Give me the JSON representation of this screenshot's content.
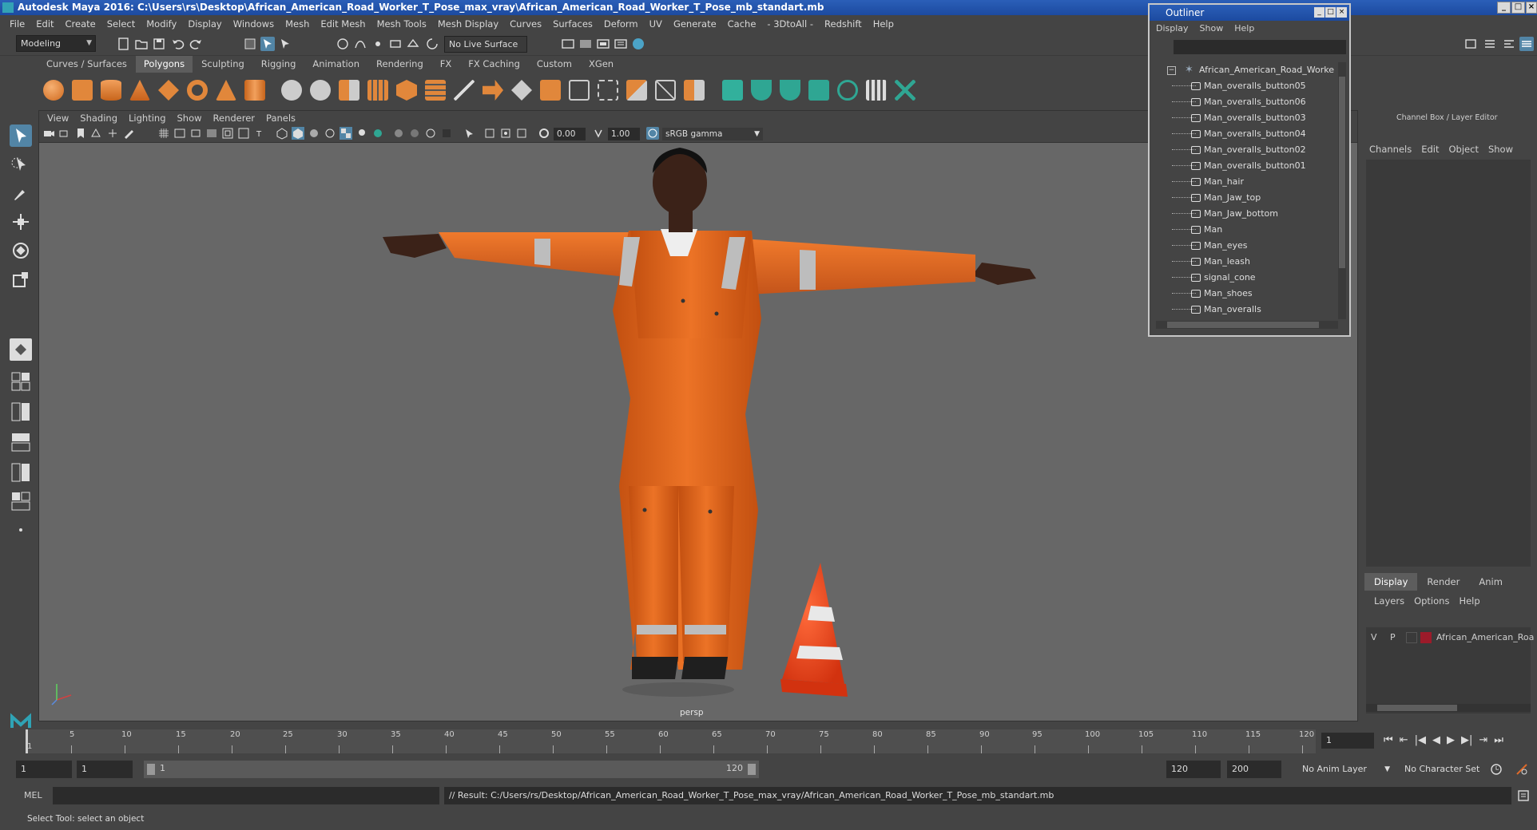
{
  "window": {
    "title": "Autodesk Maya 2016: C:\\Users\\rs\\Desktop\\African_American_Road_Worker_T_Pose_max_vray\\African_American_Road_Worker_T_Pose_mb_standart.mb"
  },
  "menu": [
    "File",
    "Edit",
    "Create",
    "Select",
    "Modify",
    "Display",
    "Windows",
    "Mesh",
    "Edit Mesh",
    "Mesh Tools",
    "Mesh Display",
    "Curves",
    "Surfaces",
    "Deform",
    "UV",
    "Generate",
    "Cache",
    "- 3DtoAll -",
    "Redshift",
    "Help"
  ],
  "status_line": {
    "mode": "Modeling",
    "live_surface": "No Live Surface"
  },
  "shelf_tabs": [
    "Curves / Surfaces",
    "Polygons",
    "Sculpting",
    "Rigging",
    "Animation",
    "Rendering",
    "FX",
    "FX Caching",
    "Custom",
    "XGen"
  ],
  "shelf_active": "Polygons",
  "viewport": {
    "menu": [
      "View",
      "Shading",
      "Lighting",
      "Show",
      "Renderer",
      "Panels"
    ],
    "exposure": "0.00",
    "gamma": "1.00",
    "color_space": "sRGB gamma",
    "camera": "persp"
  },
  "outliner": {
    "title": "Outliner",
    "menu": [
      "Display",
      "Show",
      "Help"
    ],
    "root": "African_American_Road_Worker_",
    "items": [
      "Man_overalls_button05",
      "Man_overalls_button06",
      "Man_overalls_button03",
      "Man_overalls_button04",
      "Man_overalls_button02",
      "Man_overalls_button01",
      "Man_hair",
      "Man_Jaw_top",
      "Man_Jaw_bottom",
      "Man",
      "Man_eyes",
      "Man_leash",
      "signal_cone",
      "Man_shoes",
      "Man_overalls"
    ]
  },
  "channel_box": {
    "title": "Channel Box / Layer Editor",
    "menu": [
      "Channels",
      "Edit",
      "Object",
      "Show"
    ],
    "tabs": [
      "Display",
      "Render",
      "Anim"
    ],
    "active_tab": "Display",
    "layer_menu": [
      "Layers",
      "Options",
      "Help"
    ],
    "layer": {
      "v": "V",
      "p": "P",
      "name": "African_American_Roa",
      "color": "#9c1b2a"
    }
  },
  "timeline": {
    "ticks": [
      "5",
      "10",
      "15",
      "20",
      "25",
      "30",
      "35",
      "40",
      "45",
      "50",
      "55",
      "60",
      "65",
      "70",
      "75",
      "80",
      "85",
      "90",
      "95",
      "100",
      "105",
      "110",
      "115",
      "120"
    ],
    "start_label": "1",
    "current_frame": "1"
  },
  "range": {
    "start": "1",
    "playback_start": "1",
    "slider_start": "1",
    "slider_end": "120",
    "playback_end": "120",
    "end": "200",
    "anim_layer": "No Anim Layer",
    "character_set": "No Character Set"
  },
  "command_line": {
    "label": "MEL",
    "result": "// Result: C:/Users/rs/Desktop/African_American_Road_Worker_T_Pose_max_vray/African_American_Road_Worker_T_Pose_mb_standart.mb"
  },
  "help_line": "Select Tool: select an object",
  "colors": {
    "overalls": "#e2661a",
    "reflective": "#bdbdbd",
    "skin": "#3b2218",
    "cone": "#f0431c",
    "viewport_bg": "#676767"
  }
}
